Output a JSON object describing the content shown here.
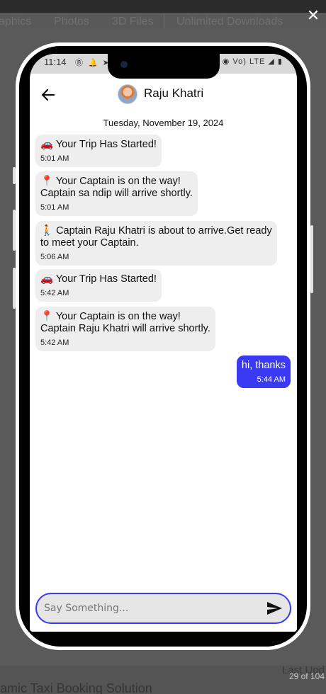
{
  "background": {
    "nav_items": [
      "aphics",
      "Photos",
      "3D Files",
      "Unlimited Downloads"
    ],
    "footer_title": "amic Taxi Booking Solution",
    "last_updated_label": "Last Upd",
    "image_counter": "29 of 104"
  },
  "status_bar": {
    "time": "11:14",
    "left_icons": "Ⓑ 🔔 ➤",
    "right_icons": "◉ Vo) LTE ◢ ▮"
  },
  "chat": {
    "contact_name": "Raju Khatri",
    "date_label": "Tuesday, November 19, 2024",
    "messages": [
      {
        "text": "🚗 Your Trip Has Started!",
        "time": "5:01 AM"
      },
      {
        "text": "📍 Your Captain is on the way!\nCaptain sa ndip will arrive shortly.",
        "time": "5:01 AM"
      },
      {
        "text": "🚶 Captain Raju Khatri is about to arrive.Get ready\nto meet your Captain.",
        "time": "5:06 AM"
      },
      {
        "text": "🚗 Your Trip Has Started!",
        "time": "5:42 AM"
      },
      {
        "text": "📍 Your Captain is on the way!\nCaptain Raju Khatri will arrive shortly.",
        "time": "5:42 AM"
      },
      {
        "text": "hi, thanks",
        "time": "5:44 AM"
      }
    ],
    "composer_placeholder": "Say Something..."
  },
  "colors": {
    "accent": "#3a3af5",
    "incoming_bubble": "#eeeeee",
    "overlay": "#5a5a5a"
  }
}
